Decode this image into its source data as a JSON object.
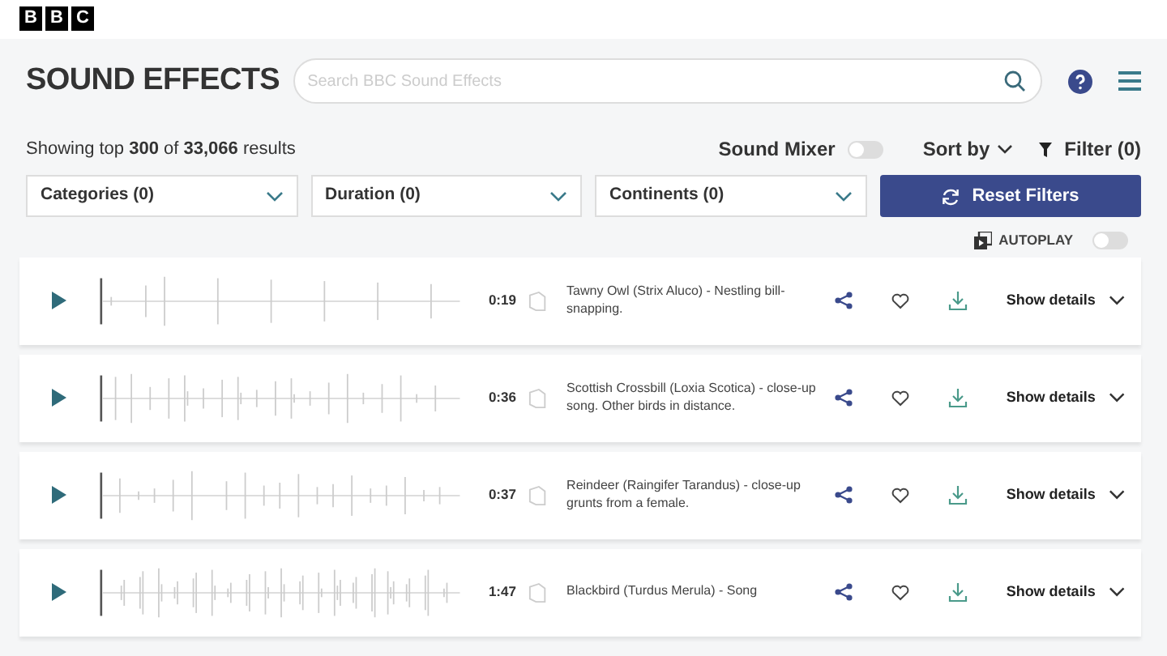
{
  "logo": [
    "B",
    "B",
    "C"
  ],
  "header": {
    "title": "SOUND EFFECTS",
    "search": {
      "placeholder": "Search BBC Sound Effects"
    }
  },
  "results": {
    "text": "Showing top **300** of **33,066** results"
  },
  "sound_mixer": {
    "label": "Sound Mixer",
    "on": false
  },
  "sort": {
    "label": "Sort by"
  },
  "filter": {
    "label": "Filter (0)"
  },
  "dropdowns": [
    {
      "label": "Categories (0)"
    },
    {
      "label": "Duration (0)"
    },
    {
      "label": "Continents (0)"
    }
  ],
  "reset_button": {
    "label": "Reset Filters"
  },
  "autoplay": {
    "label": "AUTOPLAY",
    "on": false
  },
  "tracks": [
    {
      "duration": "0:19",
      "description": "Tawny Owl (Strix Aluco) - Nestling bill-snapping.",
      "details": "Show details"
    },
    {
      "duration": "0:36",
      "description": "Scottish Crossbill (Loxia Scotica) - close-up song. Other birds in distance.",
      "details": "Show details"
    },
    {
      "duration": "0:37",
      "description": "Reindeer (Raingifer Tarandus) - close-up grunts from a female.",
      "details": "Show details"
    },
    {
      "duration": "1:47",
      "description": "Blackbird (Turdus Merula) - Song",
      "details": "Show details"
    }
  ]
}
